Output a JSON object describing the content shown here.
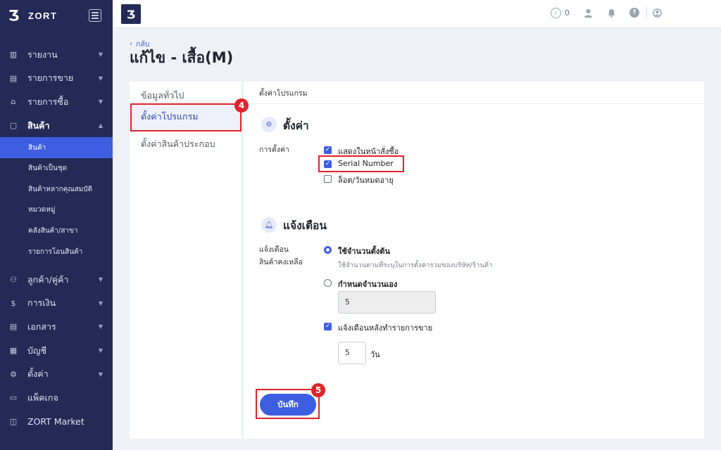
{
  "app": {
    "brand": "ZORT",
    "logo_glyph": "Ʒ"
  },
  "sidebar": {
    "items": [
      {
        "label": "รายงาน",
        "icon": "bar-chart-icon"
      },
      {
        "label": "รายการขาย",
        "icon": "clipboard-icon"
      },
      {
        "label": "รายการซื้อ",
        "icon": "basket-icon"
      },
      {
        "label": "สินค้า",
        "icon": "box-icon"
      }
    ],
    "sub_items": [
      "สินค้า",
      "สินค้าเป็นชุด",
      "สินค้าหลากคุณสมบัติ",
      "หมวดหมู่",
      "คลังสินค้า/สาขา",
      "รายการโอนสินค้า"
    ],
    "items_after": [
      {
        "label": "ลูกค้า/คู่ค้า",
        "icon": "users-icon"
      },
      {
        "label": "การเงิน",
        "icon": "dollar-icon"
      },
      {
        "label": "เอกสาร",
        "icon": "document-icon"
      },
      {
        "label": "บัญชี",
        "icon": "ledger-icon"
      },
      {
        "label": "ตั้งค่า",
        "icon": "gear-icon"
      },
      {
        "label": "แพ็คเกจ",
        "icon": "package-icon"
      },
      {
        "label": "ZORT Market",
        "icon": "bag-icon"
      }
    ]
  },
  "topbar": {
    "notification_count": "0"
  },
  "header": {
    "back_label": "กลับ",
    "title": "แก้ไข - เสื้อ(M)"
  },
  "tabs": [
    "ข้อมูลทั่วไป",
    "ตั้งค่าโปรแกรม",
    "ตั้งค่าสินค้าประกอบ"
  ],
  "content": {
    "card_title": "ตั้งค่าโปรแกรม",
    "settings": {
      "title": "ตั้งค่า",
      "field_label": "การตั้งค่า",
      "options": [
        {
          "label": "แสดงในหน้าสั่งซื้อ",
          "checked": true
        },
        {
          "label": "Serial Number",
          "checked": true
        },
        {
          "label": "ล็อต/วันหมดอายุ",
          "checked": false
        }
      ]
    },
    "alert": {
      "title": "แจ้งเตือน",
      "field_label_1": "แจ้งเตือน",
      "field_label_2": "สินค้าคงเหลือ",
      "radio_default": "ใช้จำนวนตั้งต้น",
      "radio_default_hint": "ใช้จำนวนตามที่ระบุในการตั้งค่ารวมของบริษัท/ร้านค้า",
      "radio_custom": "กำหนดจำนวนเอง",
      "custom_value": "5",
      "after_sale_label": "แจ้งเตือนหลังทำรายการขาย",
      "days_value": "5",
      "days_unit": "วัน"
    },
    "save_label": "บันทึก"
  },
  "annotations": {
    "step_4": "4",
    "step_5": "5"
  },
  "colors": {
    "sidebar": "#232a55",
    "accent": "#3d5ee0",
    "highlight": "#e0222b"
  }
}
